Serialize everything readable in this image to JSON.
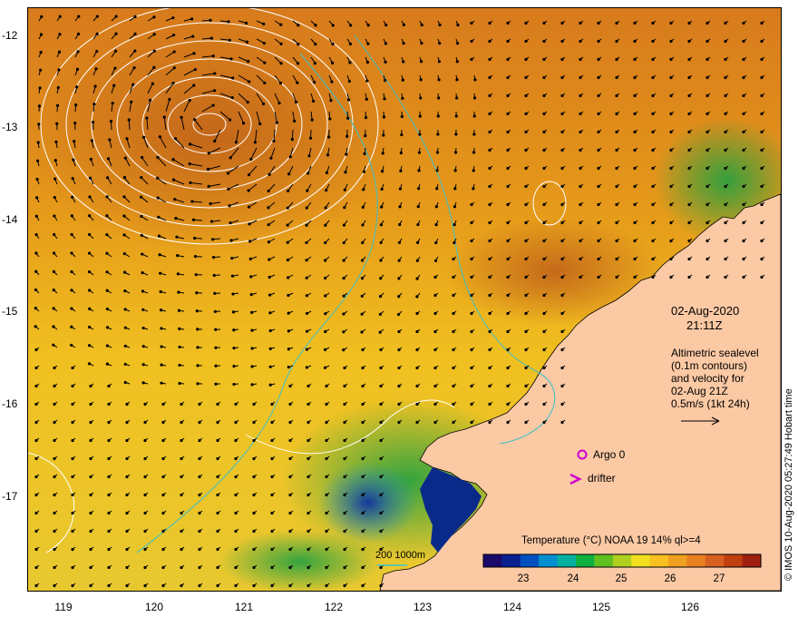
{
  "map": {
    "lat_ticks": [
      "-12",
      "-13",
      "-14",
      "-15",
      "-16",
      "-17"
    ],
    "lon_ticks": [
      "119",
      "120",
      "121",
      "122",
      "123",
      "124",
      "125",
      "126"
    ],
    "lat_range": [
      -17.95,
      -11.95
    ],
    "lon_range": [
      118.6,
      126.95
    ],
    "colors": {
      "land": "#fbc9a4",
      "contour": "#ffffff",
      "isobath": "#3cc0c8",
      "vectors": "#000000",
      "argo": "#d000d0"
    }
  },
  "annotations": {
    "date": "02-Aug-2020",
    "time": "21:11Z",
    "desc_lines": [
      "Altimetric sealevel",
      "(0.1m contours)",
      "and velocity for",
      "02-Aug 21Z",
      "0.5m/s (1kt 24h)"
    ],
    "argo_label": "Argo 0",
    "drifter_label": "drifter",
    "depth_label": "200  1000m"
  },
  "colorbar": {
    "title": "Temperature (°C) NOAA 19 14% ql>=4",
    "ticks": [
      "23",
      "24",
      "25",
      "26",
      "27"
    ],
    "range": [
      22.2,
      27.8
    ]
  },
  "credit": "© IMOS 10-Aug-2020 05:27:49 Hobart time"
}
